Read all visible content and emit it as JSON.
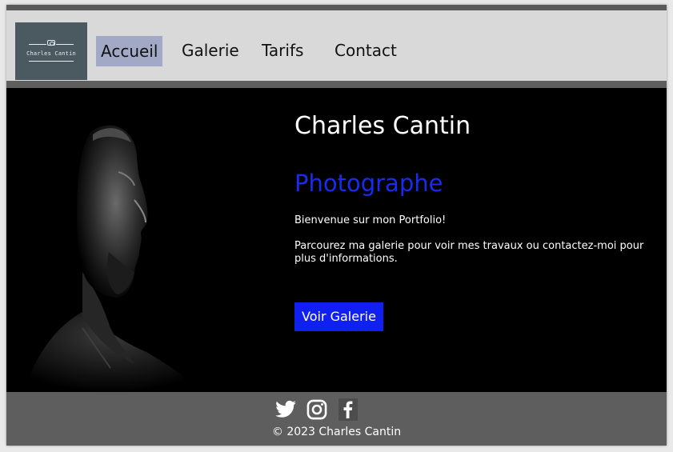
{
  "logo": {
    "text": "Charles Cantin",
    "icon": "camera-icon"
  },
  "nav": {
    "items": [
      {
        "label": "Accueil",
        "active": true
      },
      {
        "label": "Galerie",
        "active": false
      },
      {
        "label": "Tarifs",
        "active": false
      },
      {
        "label": "Contact",
        "active": false
      }
    ]
  },
  "hero": {
    "name": "Charles Cantin",
    "role": "Photographe",
    "welcome": "Bienvenue sur mon Portfolio!",
    "description": "Parcourez ma galerie pour voir mes travaux ou contactez-moi pour plus d'informations.",
    "cta_label": "Voir Galerie",
    "image": "portrait-photo"
  },
  "footer": {
    "social_icons": [
      "twitter-icon",
      "instagram-icon",
      "facebook-icon"
    ],
    "copyright": "© 2023 Charles Cantin"
  },
  "colors": {
    "nav_active_bg": "#a2a9c7",
    "role_text": "#1a2bf0",
    "cta_bg": "#1020f0",
    "hero_bg": "#000000",
    "footer_bg": "#5e5e5e"
  }
}
